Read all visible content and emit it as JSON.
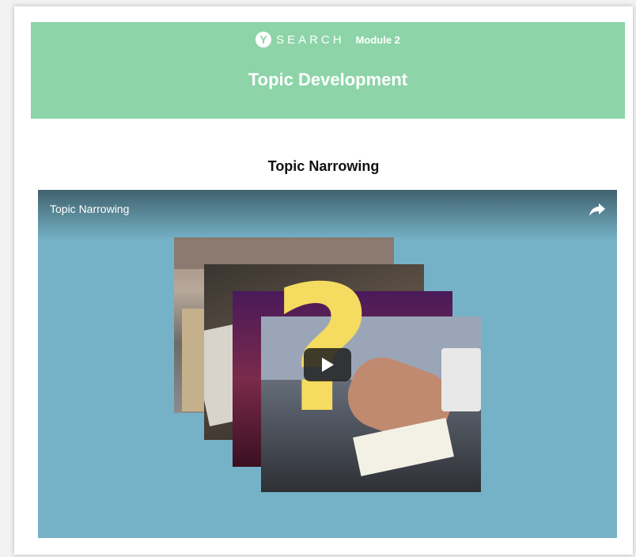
{
  "header": {
    "brand": "SEARCH",
    "logo_letter": "Y",
    "module": "Module 2",
    "title": "Topic Development"
  },
  "section": {
    "title": "Topic Narrowing"
  },
  "video": {
    "title": "Topic Narrowing",
    "share_icon": "share-icon",
    "play_icon": "play-icon",
    "center_symbol": "?"
  },
  "colors": {
    "banner": "#8dd4a8",
    "video_bg": "#75b2c7",
    "question_mark": "#f5db5f"
  }
}
